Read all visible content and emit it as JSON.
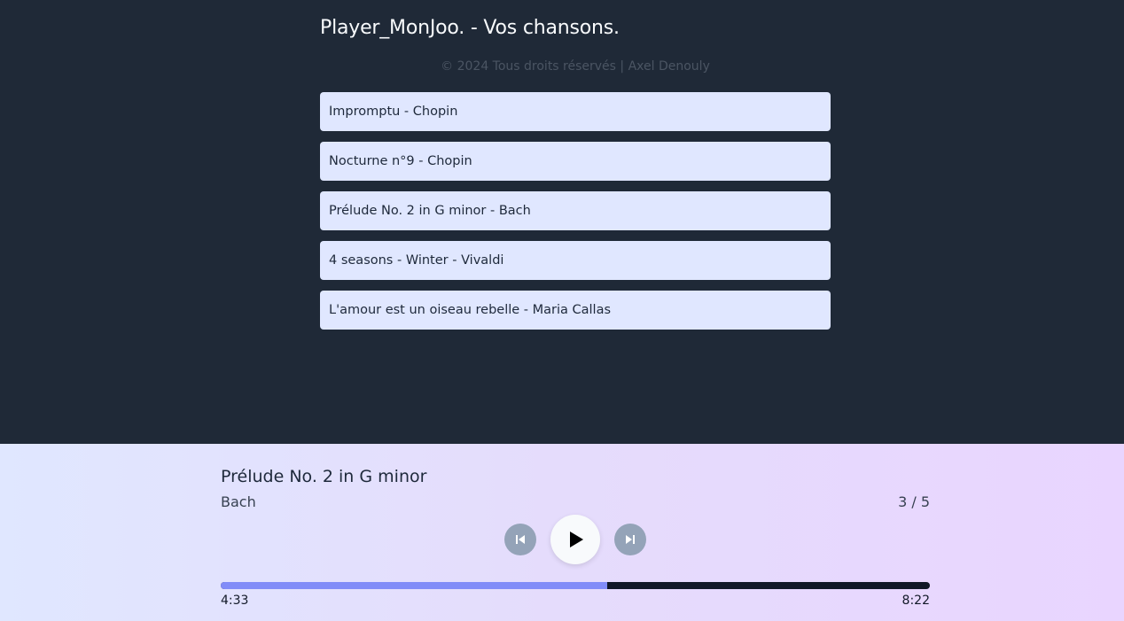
{
  "header": {
    "title": "Player_MonJoo. - Vos chansons.",
    "copyright": "© 2024 Tous droits réservés | Axel Denouly"
  },
  "songs": [
    {
      "label": "Impromptu - Chopin"
    },
    {
      "label": "Nocturne n°9 - Chopin"
    },
    {
      "label": "Prélude No. 2 in G minor - Bach"
    },
    {
      "label": "4 seasons - Winter - Vivaldi"
    },
    {
      "label": "L'amour est un oiseau rebelle - Maria Callas"
    }
  ],
  "player": {
    "title": "Prélude No. 2 in G minor",
    "artist": "Bach",
    "counter": "3 / 5",
    "current_time": "4:33",
    "total_time": "8:22",
    "progress_fraction": 0.545,
    "icons": {
      "previous": "skip-previous-icon",
      "play": "play-icon",
      "next": "skip-next-icon"
    }
  },
  "colors": {
    "background": "#1f2937",
    "song_item": "#e0e7ff",
    "progress_fill": "#818cf8",
    "progress_track": "#111827"
  }
}
